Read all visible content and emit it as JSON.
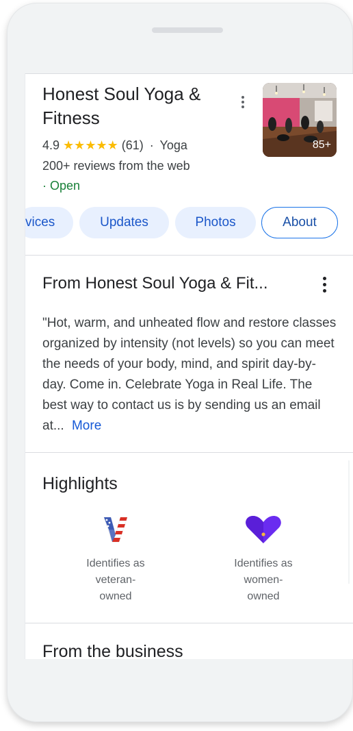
{
  "business": {
    "name": "Honest Soul Yoga & Fitness",
    "rating": "4.9",
    "stars": "★★★★★",
    "review_count": "(61)",
    "separator": "·",
    "category": "Yoga",
    "web_reviews": "200+ reviews from the web",
    "status": "· Open",
    "photo_count": "85+"
  },
  "tabs": [
    {
      "label": "vices",
      "active": false
    },
    {
      "label": "Updates",
      "active": false
    },
    {
      "label": "Photos",
      "active": false
    },
    {
      "label": "About",
      "active": true
    }
  ],
  "from_section": {
    "title": "From Honest Soul Yoga & Fit...",
    "description": "\"Hot, warm, and unheated flow and restore classes organized by intensity (not levels) so you can meet the needs of your body, mind, and spirit day-by-day. Come in. Celebrate Yoga in Real Life. The best way to contact us is by sending us an email at...",
    "more_link": "More"
  },
  "highlights": {
    "title": "Highlights",
    "items": [
      {
        "icon": "veteran-flag-v-icon",
        "label_lines": [
          "Identifies as",
          "veteran-",
          "owned"
        ]
      },
      {
        "icon": "purple-heart-icon",
        "label_lines": [
          "Identifies as",
          "women-",
          "owned"
        ]
      }
    ]
  },
  "from_business": {
    "title": "From the business"
  },
  "colors": {
    "chip_bg": "#e8f0fe",
    "chip_text": "#1a56c9",
    "open_green": "#188038",
    "star_yellow": "#fbbc04",
    "link_blue": "#1558d6",
    "women_purple": "#6a2cf0"
  }
}
